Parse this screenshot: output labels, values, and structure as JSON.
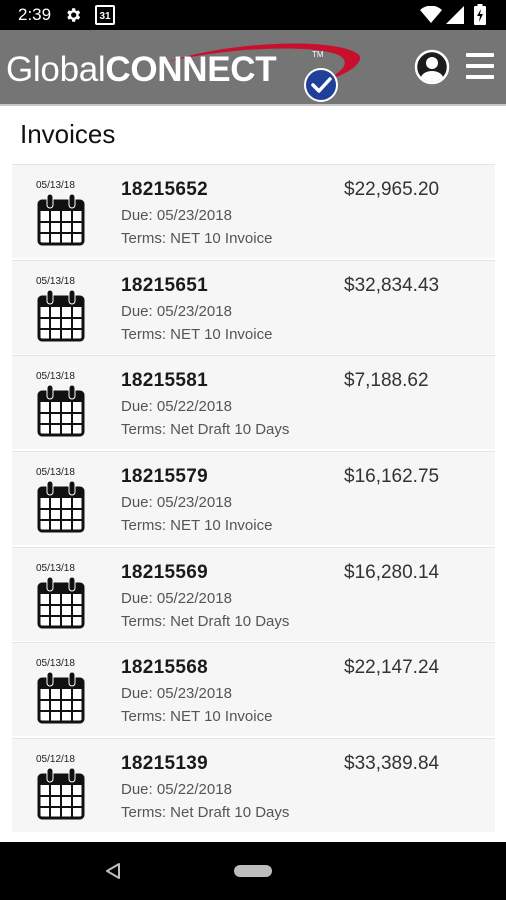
{
  "status_bar": {
    "time": "2:39",
    "calendar_day": "31",
    "icons": [
      "gear-icon",
      "calendar-icon",
      "wifi-icon",
      "signal-icon",
      "battery-icon"
    ]
  },
  "app_bar": {
    "logo_light": "Global",
    "logo_bold": "CONNECT",
    "logo_tm": "TM",
    "icons": [
      "account-icon",
      "menu-icon"
    ],
    "colors": {
      "bar": "#757575",
      "swoosh": "#c8102e",
      "check": "#1f3f99"
    }
  },
  "page": {
    "title": "Invoices"
  },
  "invoices": [
    {
      "date": "05/13/18",
      "number": "18215652",
      "due": "Due: 05/23/2018",
      "terms": "Terms: NET 10 Invoice",
      "amount": "$22,965.20"
    },
    {
      "date": "05/13/18",
      "number": "18215651",
      "due": "Due: 05/23/2018",
      "terms": "Terms: NET 10 Invoice",
      "amount": "$32,834.43"
    },
    {
      "date": "05/13/18",
      "number": "18215581",
      "due": "Due: 05/22/2018",
      "terms": "Terms: Net Draft 10 Days",
      "amount": "$7,188.62"
    },
    {
      "date": "05/13/18",
      "number": "18215579",
      "due": "Due: 05/23/2018",
      "terms": "Terms: NET 10 Invoice",
      "amount": "$16,162.75"
    },
    {
      "date": "05/13/18",
      "number": "18215569",
      "due": "Due: 05/22/2018",
      "terms": "Terms: Net Draft 10 Days",
      "amount": "$16,280.14"
    },
    {
      "date": "05/13/18",
      "number": "18215568",
      "due": "Due: 05/23/2018",
      "terms": "Terms: NET 10 Invoice",
      "amount": "$22,147.24"
    },
    {
      "date": "05/12/18",
      "number": "18215139",
      "due": "Due: 05/22/2018",
      "terms": "Terms: Net Draft 10 Days",
      "amount": "$33,389.84"
    }
  ],
  "nav_bar": {
    "icons": [
      "back-icon",
      "home-icon"
    ]
  }
}
